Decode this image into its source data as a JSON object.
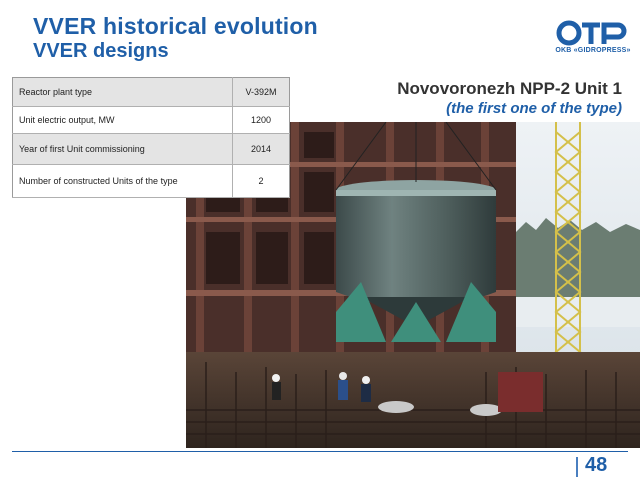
{
  "slide": {
    "title": "VVER historical evolution",
    "subtitle": "VVER designs",
    "logo_caption": "OKB «GIDROPRESS»",
    "headline": "Novovoronezh NPP-2 Unit 1",
    "headline_sub": "(the first one of the type)",
    "page_number": "48"
  },
  "table": {
    "rows": [
      {
        "label": "Reactor plant type",
        "value": "V-392M"
      },
      {
        "label": "Unit electric output, MW",
        "value": "1200"
      },
      {
        "label": "Year of first Unit commissioning",
        "value": "2014"
      },
      {
        "label": "Number of constructed Units of the type",
        "value": "2"
      }
    ]
  },
  "colors": {
    "accent": "#1f5fa8",
    "headline": "#333333",
    "table_shade": "#e4e4e4"
  },
  "icons": {
    "logo": "okb-gidropress-logo"
  }
}
